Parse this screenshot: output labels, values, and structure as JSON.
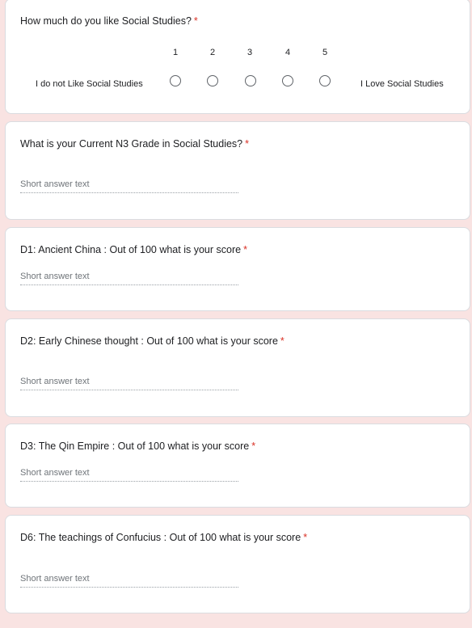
{
  "q1": {
    "title": "How much do you like Social Studies?",
    "required_mark": "*",
    "scale": [
      "1",
      "2",
      "3",
      "4",
      "5"
    ],
    "low_label": "I do not Like Social Studies",
    "high_label": "I Love Social Studies"
  },
  "q2": {
    "title": "What is your Current N3 Grade in Social Studies?",
    "required_mark": "*",
    "placeholder": "Short answer text"
  },
  "q3": {
    "title": "D1: Ancient China : Out of 100 what is your score",
    "required_mark": "*",
    "placeholder": "Short answer text"
  },
  "q4": {
    "title": "D2: Early Chinese thought : Out of 100 what is your score",
    "required_mark": "*",
    "placeholder": "Short answer text"
  },
  "q5": {
    "title": "D3: The Qin Empire : Out of 100 what is your score",
    "required_mark": "*",
    "placeholder": "Short answer text"
  },
  "q6": {
    "title": "D6: The teachings of Confucius : Out of 100 what is your score",
    "required_mark": "*",
    "placeholder": "Short answer text"
  },
  "colors": {
    "background": "#f9e3e2",
    "required": "#d93025",
    "card": "#ffffff"
  }
}
